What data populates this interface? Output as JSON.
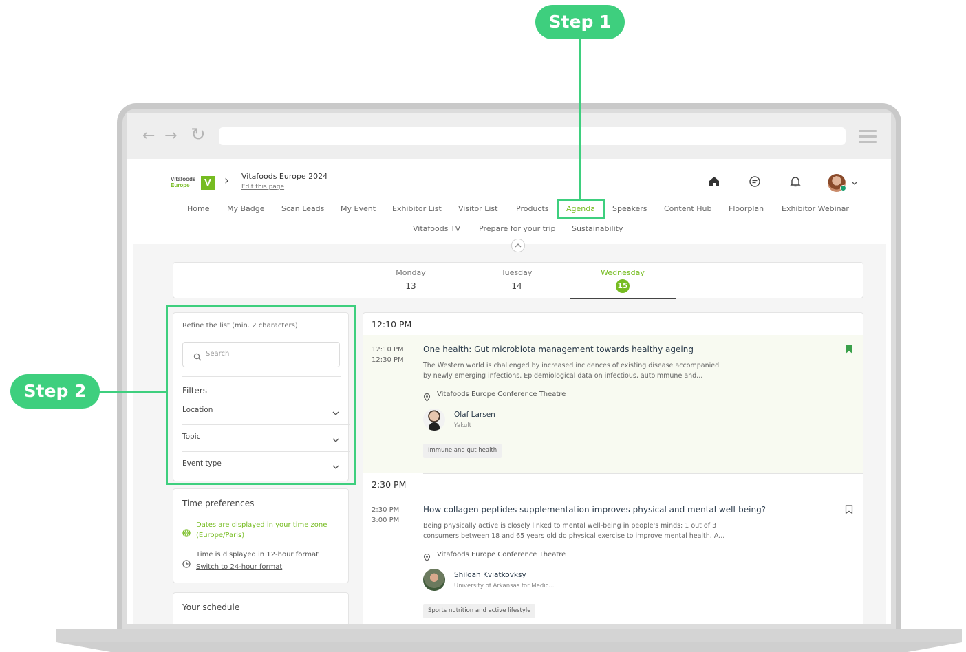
{
  "annotations": {
    "step1": "Step 1",
    "step2": "Step 2"
  },
  "brand": {
    "logo_line1": "Vitafoods",
    "logo_line2": "Europe",
    "logo_mark": "V",
    "accent_color": "#76bc21",
    "annotation_color": "#3ecf7e"
  },
  "header": {
    "event_title": "Vitafoods Europe 2024",
    "edit_link": "Edit this page"
  },
  "icons": {
    "home": "home-icon",
    "chat": "chat-icon",
    "bell": "bell-icon",
    "avatar": "user-avatar"
  },
  "nav": {
    "row1": [
      "Home",
      "My Badge",
      "Scan Leads",
      "My Event",
      "Exhibitor List",
      "Visitor List",
      "Products",
      "Agenda",
      "Speakers",
      "Content Hub",
      "Floorplan",
      "Exhibitor Webinar"
    ],
    "row2": [
      "Vitafoods TV",
      "Prepare for your trip",
      "Sustainability"
    ],
    "active": "Agenda"
  },
  "days": [
    {
      "name": "Monday",
      "num": "13"
    },
    {
      "name": "Tuesday",
      "num": "14"
    },
    {
      "name": "Wednesday",
      "num": "15",
      "active": true
    }
  ],
  "filters": {
    "refine_label": "Refine the list (min. 2 characters)",
    "search_placeholder": "Search",
    "title": "Filters",
    "items": [
      "Location",
      "Topic",
      "Event type"
    ]
  },
  "time_prefs": {
    "title": "Time preferences",
    "timezone_text": "Dates are displayed in your time zone (Europe/Paris)",
    "format_text": "Time is displayed in 12-hour format",
    "format_link": "Switch to 24-hour format"
  },
  "schedule": {
    "title": "Your schedule"
  },
  "sessions": [
    {
      "group_time": "12:10 PM",
      "start": "12:10 PM",
      "end": "12:30 PM",
      "title": "One health: Gut microbiota management towards healthy ageing",
      "desc_line1": "The Western world is challenged by increased incidences of existing disease accompanied",
      "desc_line2": "by newly emerging infections. Epidemiological data on infectious, autoimmune and...",
      "location": "Vitafoods Europe Conference Theatre",
      "speaker_name": "Olaf Larsen",
      "speaker_org": "Yakult",
      "tag": "Immune and gut health",
      "bookmarked": true
    },
    {
      "group_time": "2:30 PM",
      "start": "2:30 PM",
      "end": "3:00 PM",
      "title": "How collagen peptides supplementation improves physical and mental well-being?",
      "desc_line1": "Being physically active is closely linked to mental well-being in people's minds: 1 out of 3",
      "desc_line2": "consumers between 18 and 65 years old do physical exercise to improve mental health. A...",
      "location": "Vitafoods Europe Conference Theatre",
      "speaker_name": "Shiloah Kviatkovksy",
      "speaker_org": "University of Arkansas for Medic...",
      "tag": "Sports nutrition and active lifestyle",
      "bookmarked": false
    }
  ]
}
